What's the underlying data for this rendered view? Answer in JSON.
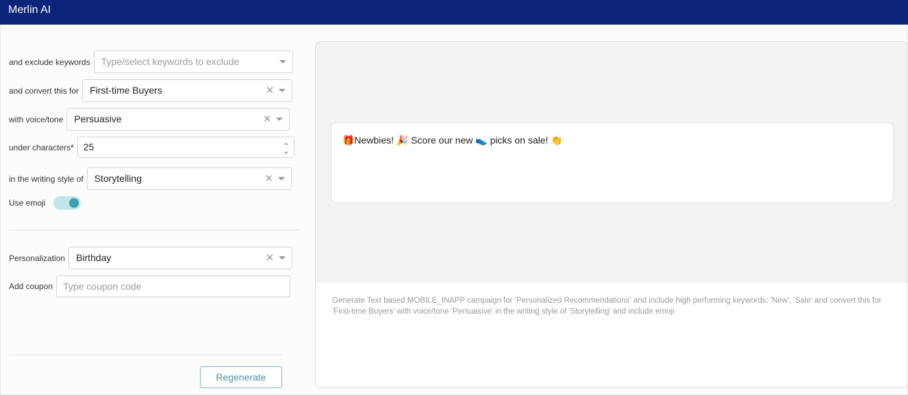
{
  "app": {
    "title": "Merlin AI"
  },
  "form": {
    "exclude_keywords": {
      "label": "and exclude keywords",
      "placeholder": "Type/select keywords to exclude"
    },
    "convert_for": {
      "label": "and convert this for",
      "value": "First-time Buyers"
    },
    "voice_tone": {
      "label": "with voice/tone",
      "value": "Persuasive"
    },
    "under_characters": {
      "label": "under characters*",
      "value": "25"
    },
    "writing_style": {
      "label": "in the writing style of",
      "value": "Storytelling"
    },
    "use_emoji": {
      "label": "Use emoji",
      "enabled": true
    },
    "personalization": {
      "label": "Personalization",
      "value": "Birthday"
    },
    "coupon": {
      "label": "Add coupon",
      "placeholder": "Type coupon code"
    },
    "regenerate_label": "Regenerate"
  },
  "preview": {
    "message": "🎁Newbies! 🎉 Score our new 👟 picks on sale! 👏",
    "prompt": "Generate Text based MOBILE_INAPP campaign for 'Personalized Recommendations' and include high performing keywords: 'New', 'Sale' and convert this for 'First-time Buyers' with voice/tone 'Persuasive' in the writing style of 'Storytelling' and include emoji"
  },
  "icons": {
    "clear": "clear-icon",
    "dropdown": "chevron-down-icon"
  },
  "colors": {
    "title_bar": "#0b2379",
    "toggle_on": "#3aa1ad",
    "button_text": "#4a8ea0"
  }
}
